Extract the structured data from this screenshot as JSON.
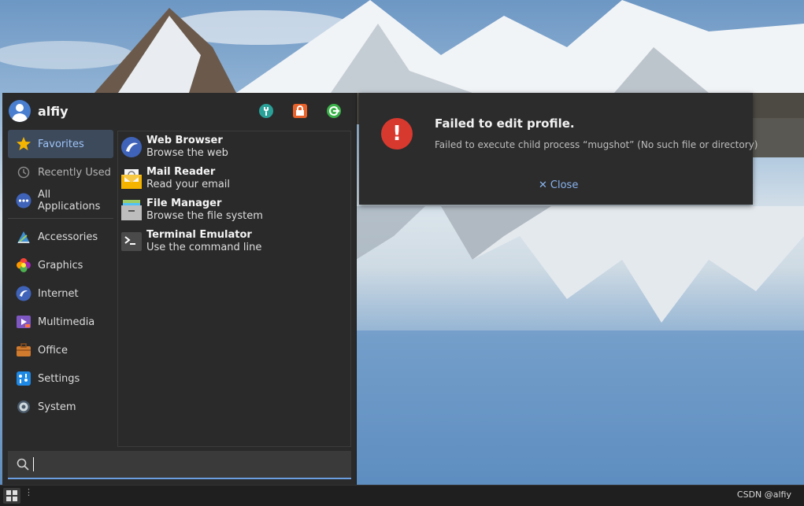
{
  "menu": {
    "user": {
      "name": "alfiy",
      "avatar_icon": "user-avatar-icon"
    },
    "actions": [
      {
        "name": "settings-manager-icon",
        "color": "#2aa198"
      },
      {
        "name": "lock-screen-icon",
        "color": "#e8622c"
      },
      {
        "name": "logout-icon",
        "color": "#3bb34a"
      }
    ],
    "categories": [
      {
        "label": "Favorites",
        "icon": "star-icon",
        "active": true
      },
      {
        "label": "Recently Used",
        "icon": "clock-icon"
      },
      {
        "label": "All Applications",
        "icon": "more-dots-icon"
      },
      {
        "label": "Accessories",
        "icon": "accessories-icon"
      },
      {
        "label": "Graphics",
        "icon": "graphics-icon"
      },
      {
        "label": "Internet",
        "icon": "internet-icon"
      },
      {
        "label": "Multimedia",
        "icon": "multimedia-icon"
      },
      {
        "label": "Office",
        "icon": "briefcase-icon"
      },
      {
        "label": "Settings",
        "icon": "settings-icon"
      },
      {
        "label": "System",
        "icon": "system-gear-icon"
      }
    ],
    "apps": [
      {
        "name": "Web Browser",
        "desc": "Browse the web",
        "icon": "web-browser-icon"
      },
      {
        "name": "Mail Reader",
        "desc": "Read your email",
        "icon": "mail-reader-icon"
      },
      {
        "name": "File Manager",
        "desc": "Browse the file system",
        "icon": "file-manager-icon"
      },
      {
        "name": "Terminal Emulator",
        "desc": "Use the command line",
        "icon": "terminal-icon"
      }
    ],
    "search": {
      "value": "",
      "placeholder": ""
    }
  },
  "dialog": {
    "title": "Failed to edit profile.",
    "message": "Failed to execute child process “mugshot” (No such file or directory)",
    "close_label": "Close",
    "accent": "#d8392f"
  },
  "taskbar": {
    "watermark": "CSDN @alfiy"
  }
}
